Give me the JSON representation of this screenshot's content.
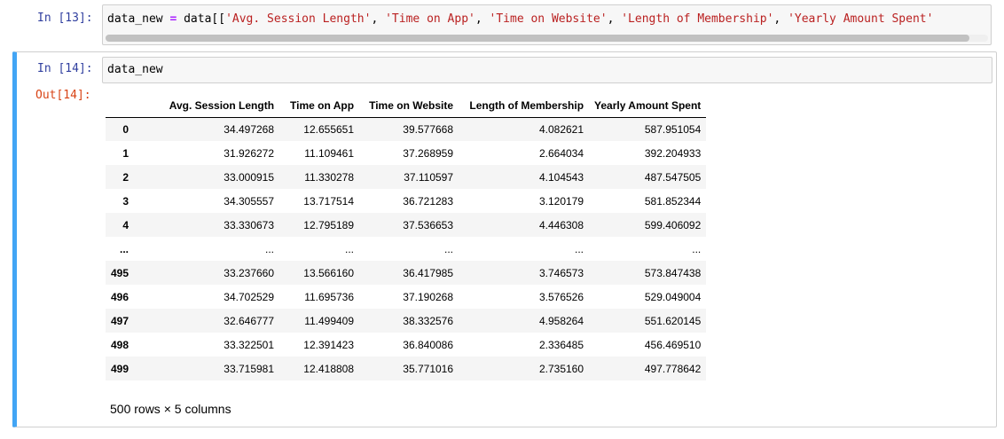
{
  "cells": {
    "cell13": {
      "in_prompt": "In [13]:",
      "code": {
        "var": "data_new ",
        "op": "=",
        "pre": " data[[",
        "s1": "'Avg. Session Length'",
        "s2": "'Time on App'",
        "s3": "'Time on Website'",
        "s4": "'Length of Membership'",
        "s5": "'Yearly Amount Spent'",
        "sep": ", "
      }
    },
    "cell14": {
      "in_prompt": "In [14]:",
      "code": "data_new",
      "out_prompt": "Out[14]:",
      "table": {
        "columns": [
          "Avg. Session Length",
          "Time on App",
          "Time on Website",
          "Length of Membership",
          "Yearly Amount Spent"
        ],
        "rows": [
          {
            "index": "0",
            "values": [
              "34.497268",
              "12.655651",
              "39.577668",
              "4.082621",
              "587.951054"
            ]
          },
          {
            "index": "1",
            "values": [
              "31.926272",
              "11.109461",
              "37.268959",
              "2.664034",
              "392.204933"
            ]
          },
          {
            "index": "2",
            "values": [
              "33.000915",
              "11.330278",
              "37.110597",
              "4.104543",
              "487.547505"
            ]
          },
          {
            "index": "3",
            "values": [
              "34.305557",
              "13.717514",
              "36.721283",
              "3.120179",
              "581.852344"
            ]
          },
          {
            "index": "4",
            "values": [
              "33.330673",
              "12.795189",
              "37.536653",
              "4.446308",
              "599.406092"
            ]
          },
          {
            "index": "...",
            "values": [
              "...",
              "...",
              "...",
              "...",
              "..."
            ]
          },
          {
            "index": "495",
            "values": [
              "33.237660",
              "13.566160",
              "36.417985",
              "3.746573",
              "573.847438"
            ]
          },
          {
            "index": "496",
            "values": [
              "34.702529",
              "11.695736",
              "37.190268",
              "3.576526",
              "529.049004"
            ]
          },
          {
            "index": "497",
            "values": [
              "32.646777",
              "11.499409",
              "38.332576",
              "4.958264",
              "551.620145"
            ]
          },
          {
            "index": "498",
            "values": [
              "33.322501",
              "12.391423",
              "36.840086",
              "2.336485",
              "456.469510"
            ]
          },
          {
            "index": "499",
            "values": [
              "33.715981",
              "12.418808",
              "35.771016",
              "2.735160",
              "497.778642"
            ]
          }
        ]
      },
      "summary": "500 rows × 5 columns"
    }
  },
  "colors": {
    "in_prompt": "#303F9F",
    "out_prompt": "#D84315",
    "selected_bar": "#42A5F5",
    "string_token": "#BA2121",
    "operator_token": "#AA22FF"
  }
}
